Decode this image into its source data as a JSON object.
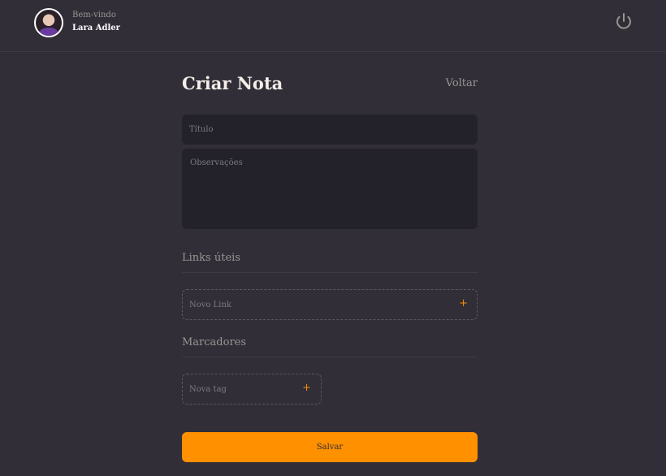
{
  "header": {
    "welcome": "Bem-vindo",
    "user_name": "Lara Adler",
    "logout_icon": "power-icon"
  },
  "page": {
    "title": "Criar Nota",
    "back_label": "Voltar"
  },
  "form": {
    "title_placeholder": "Título",
    "observations_placeholder": "Observações",
    "links_section": "Links úteis",
    "new_link_placeholder": "Novo Link",
    "tags_section": "Marcadores",
    "new_tag_placeholder": "Nova tag",
    "add_symbol": "+",
    "save_label": "Salvar"
  },
  "colors": {
    "background": "#312e38",
    "input_background": "#232129",
    "accent": "#ff9000",
    "text_light": "#f4ede8",
    "text_muted": "#999591"
  }
}
